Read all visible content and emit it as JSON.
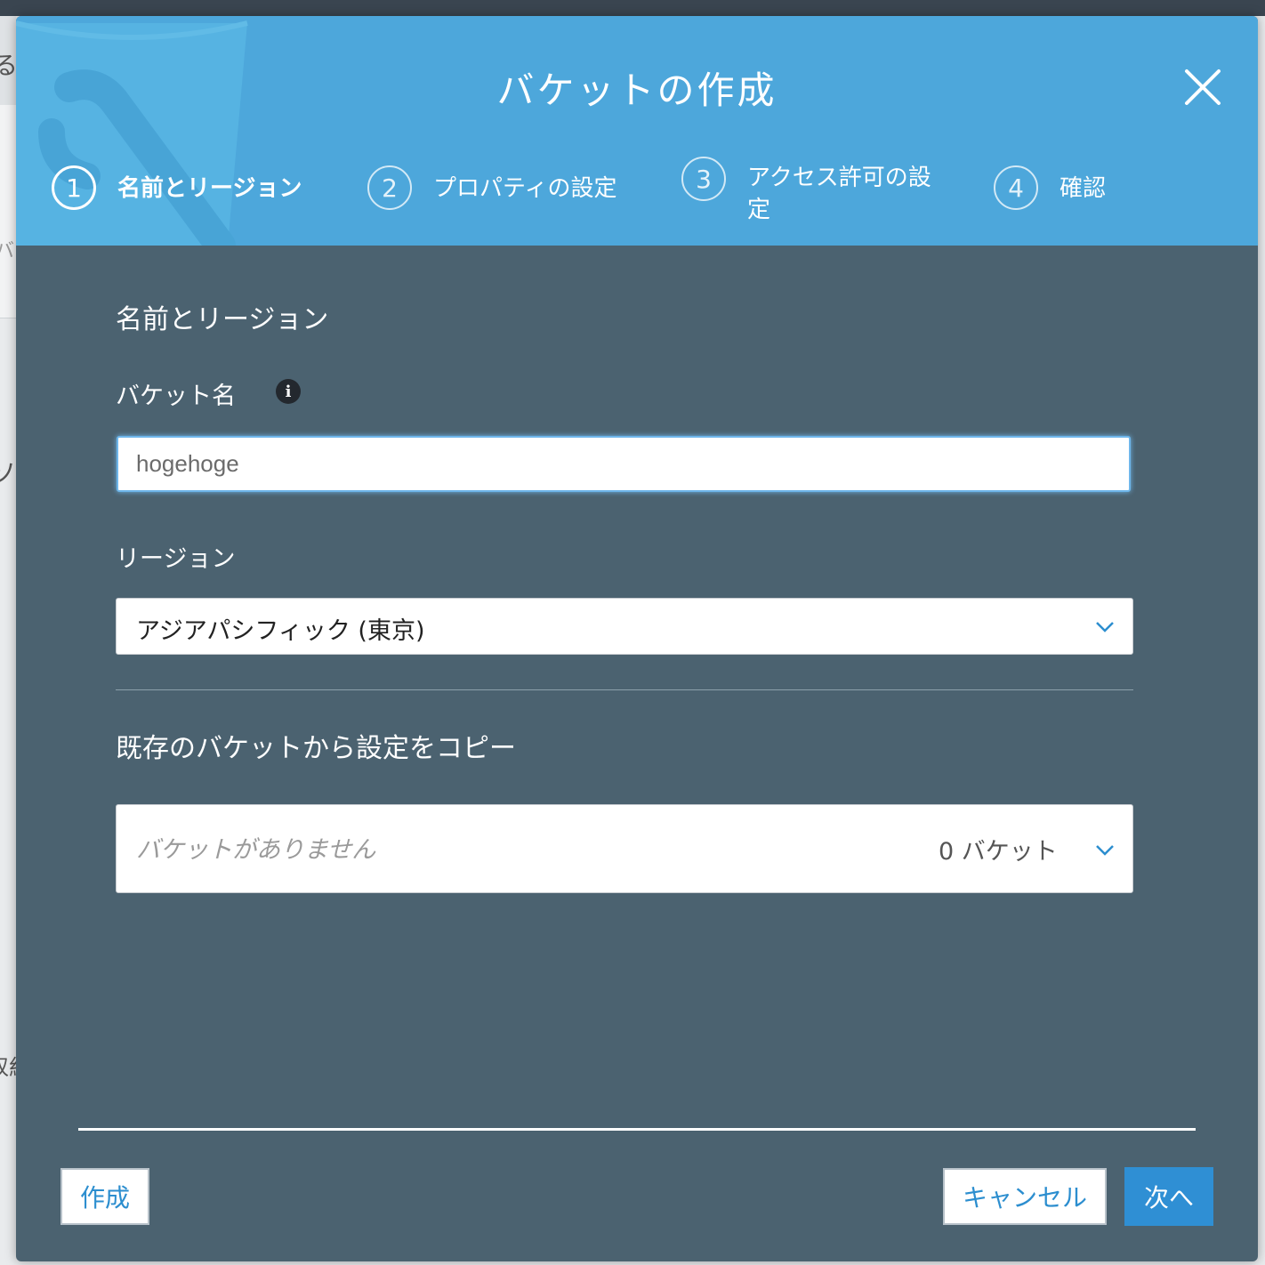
{
  "modal": {
    "title": "バケットの作成",
    "close_icon": "close-icon"
  },
  "steps": [
    {
      "number": "1",
      "label": "名前とリージョン",
      "active": true
    },
    {
      "number": "2",
      "label": "プロパティの設定",
      "active": false
    },
    {
      "number": "3",
      "label_line1": "アクセス許可の設",
      "label_line2": "定",
      "active": false
    },
    {
      "number": "4",
      "label": "確認",
      "active": false
    }
  ],
  "form": {
    "section_title": "名前とリージョン",
    "bucket_name_label": "バケット名",
    "bucket_name_value": "hogehoge",
    "info_icon": "info-icon",
    "region_label": "リージョン",
    "region_value": "アジアパシフィック (東京)",
    "copy_section_title": "既存のバケットから設定をコピー",
    "copy_placeholder": "バケットがありません",
    "copy_count": "0 バケット"
  },
  "footer": {
    "create_label": "作成",
    "cancel_label": "キャンセル",
    "next_label": "次へ"
  },
  "colors": {
    "header": "#4da7db",
    "body": "#4b6270",
    "primary_button": "#2f8fd4",
    "link_text": "#2c8ecf"
  },
  "background_glyphs": [
    "る",
    "バ",
    "ソ",
    "収約"
  ]
}
